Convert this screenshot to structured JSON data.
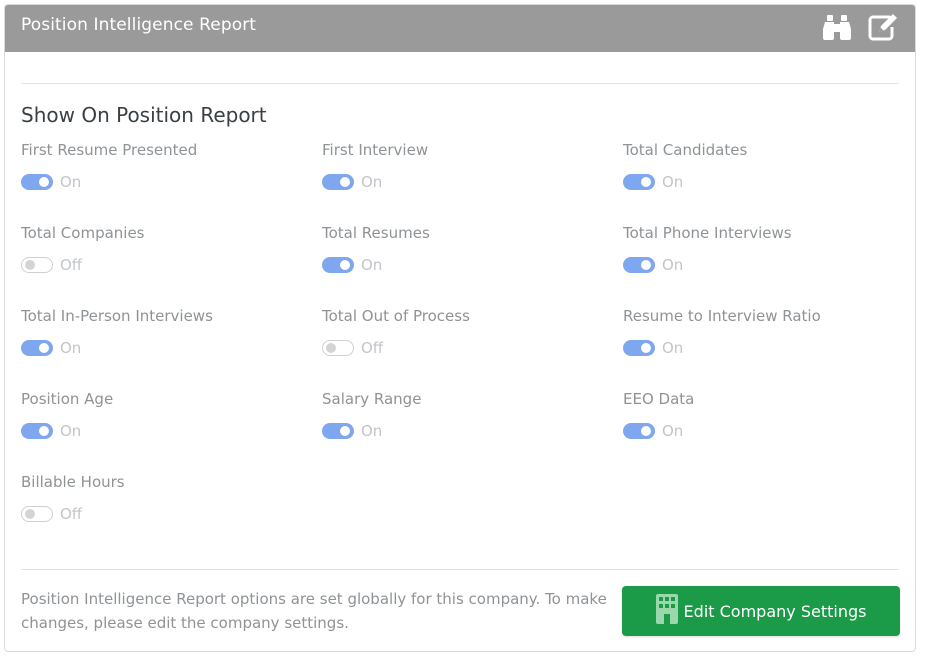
{
  "card": {
    "title": "Position Intelligence Report",
    "icons": [
      "binoculars-icon",
      "edit-icon"
    ]
  },
  "section": {
    "title": "Show On Position Report"
  },
  "settings": [
    {
      "label": "First Resume Presented",
      "state": "On",
      "enabled": true
    },
    {
      "label": "First Interview",
      "state": "On",
      "enabled": true
    },
    {
      "label": "Total Candidates",
      "state": "On",
      "enabled": true
    },
    {
      "label": "Total Companies",
      "state": "Off",
      "enabled": false
    },
    {
      "label": "Total Resumes",
      "state": "On",
      "enabled": true
    },
    {
      "label": "Total Phone Interviews",
      "state": "On",
      "enabled": true
    },
    {
      "label": "Total In-Person Interviews",
      "state": "On",
      "enabled": true
    },
    {
      "label": "Total Out of Process",
      "state": "Off",
      "enabled": false
    },
    {
      "label": "Resume to Interview Ratio",
      "state": "On",
      "enabled": true
    },
    {
      "label": "Position Age",
      "state": "On",
      "enabled": true
    },
    {
      "label": "Salary Range",
      "state": "On",
      "enabled": true
    },
    {
      "label": "EEO Data",
      "state": "On",
      "enabled": true
    },
    {
      "label": "Billable Hours",
      "state": "Off",
      "enabled": false
    }
  ],
  "footer": {
    "note": "Position Intelligence Report options are set globally for this company. To make changes, please edit the company settings.",
    "button_label": "Edit Company Settings",
    "button_icon": "building-icon"
  },
  "colors": {
    "header_bg": "#9a9a9a",
    "toggle_on": "#7fa7f0",
    "button_bg": "#1b9a48"
  }
}
